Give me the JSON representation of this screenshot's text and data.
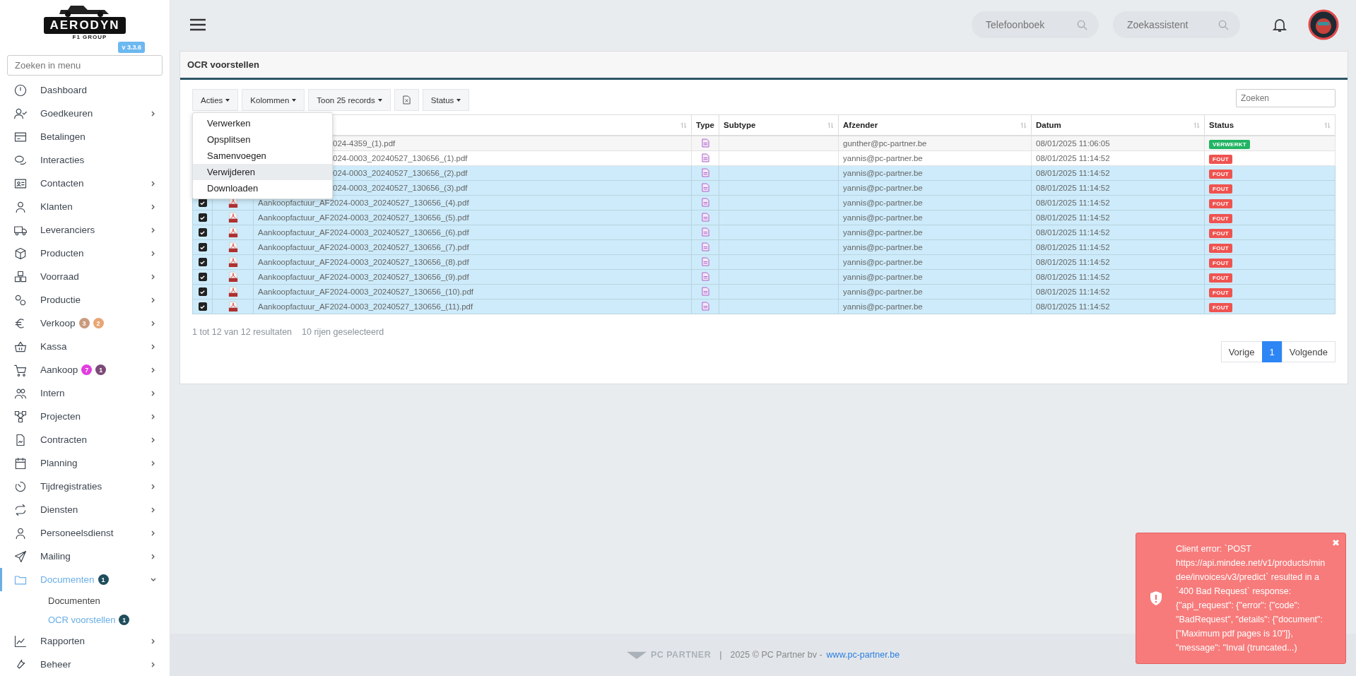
{
  "logo": {
    "name": "AERODYN",
    "tagline": "F1 GROUP",
    "version": "v 3.3.6"
  },
  "menu_search": {
    "placeholder": "Zoeken in menu"
  },
  "sidebar": {
    "items": [
      {
        "label": "Dashboard",
        "has_children": false,
        "expanded": false,
        "selected": false
      },
      {
        "label": "Goedkeuren",
        "has_children": true,
        "expanded": false,
        "selected": false
      },
      {
        "label": "Betalingen",
        "has_children": false,
        "expanded": false,
        "selected": false
      },
      {
        "label": "Interacties",
        "has_children": false,
        "expanded": false,
        "selected": false
      },
      {
        "label": "Contacten",
        "has_children": true,
        "expanded": false,
        "selected": false
      },
      {
        "label": "Klanten",
        "has_children": true,
        "expanded": false,
        "selected": false
      },
      {
        "label": "Leveranciers",
        "has_children": true,
        "expanded": false,
        "selected": false
      },
      {
        "label": "Producten",
        "has_children": true,
        "expanded": false,
        "selected": false
      },
      {
        "label": "Voorraad",
        "has_children": true,
        "expanded": false,
        "selected": false
      },
      {
        "label": "Productie",
        "has_children": true,
        "expanded": false,
        "selected": false
      },
      {
        "label": "Verkoop",
        "has_children": true,
        "expanded": false,
        "selected": false,
        "badges": [
          {
            "text": "3",
            "color": "#c99a7e"
          },
          {
            "text": "2",
            "color": "#e8a674"
          }
        ]
      },
      {
        "label": "Kassa",
        "has_children": true,
        "expanded": false,
        "selected": false
      },
      {
        "label": "Aankoop",
        "has_children": true,
        "expanded": false,
        "selected": false,
        "badges": [
          {
            "text": "7",
            "color": "#e03ee0"
          },
          {
            "text": "1",
            "color": "#7b4a78"
          }
        ]
      },
      {
        "label": "Intern",
        "has_children": true,
        "expanded": false,
        "selected": false
      },
      {
        "label": "Projecten",
        "has_children": true,
        "expanded": false,
        "selected": false
      },
      {
        "label": "Contracten",
        "has_children": true,
        "expanded": false,
        "selected": false
      },
      {
        "label": "Planning",
        "has_children": true,
        "expanded": false,
        "selected": false
      },
      {
        "label": "Tijdregistraties",
        "has_children": true,
        "expanded": false,
        "selected": false
      },
      {
        "label": "Diensten",
        "has_children": true,
        "expanded": false,
        "selected": false
      },
      {
        "label": "Personeelsdienst",
        "has_children": true,
        "expanded": false,
        "selected": false
      },
      {
        "label": "Mailing",
        "has_children": true,
        "expanded": false,
        "selected": false
      },
      {
        "label": "Documenten",
        "has_children": true,
        "expanded": true,
        "selected": true,
        "badges": [
          {
            "text": "1",
            "color": "#1f4d5c"
          }
        ],
        "children": [
          {
            "label": "Documenten",
            "selected": false
          },
          {
            "label": "OCR voorstellen",
            "selected": true,
            "badges": [
              {
                "text": "1",
                "color": "#1f4d5c"
              }
            ]
          }
        ]
      },
      {
        "label": "Rapporten",
        "has_children": true,
        "expanded": false,
        "selected": false
      },
      {
        "label": "Beheer",
        "has_children": true,
        "expanded": false,
        "selected": false
      }
    ]
  },
  "topbar": {
    "searches": [
      {
        "placeholder": "Telefoonboek"
      },
      {
        "placeholder": "Zoekassistent"
      }
    ]
  },
  "card": {
    "title": "OCR voorstellen",
    "toolbar": [
      {
        "label": "Acties",
        "kind": "dropdown"
      },
      {
        "label": "Kolommen",
        "kind": "dropdown"
      },
      {
        "label": "Toon 25 records",
        "kind": "dropdown"
      },
      {
        "kind": "excel"
      },
      {
        "label": "Status",
        "kind": "dropdown"
      }
    ],
    "actions_menu": {
      "open": true,
      "items": [
        {
          "label": "Verwerken",
          "selected": false
        },
        {
          "label": "Opsplitsen",
          "selected": false
        },
        {
          "label": "Samenvoegen",
          "selected": false
        },
        {
          "label": "Verwijderen",
          "selected": true
        },
        {
          "label": "Downloaden",
          "selected": false
        }
      ]
    },
    "search": {
      "placeholder": "Zoeken"
    },
    "table": {
      "columns": [
        "Type",
        "Subtype",
        "Afzender",
        "Datum",
        "Status"
      ],
      "rows": [
        {
          "selected": false,
          "name": "024-4359_(1).pdf",
          "sender": "gunther@pc-partner.be",
          "date": "08/01/2025 11:06:05",
          "status": {
            "label": "VERWERKT",
            "color": "#22b463"
          }
        },
        {
          "selected": false,
          "name": "024-0003_20240527_130656_(1).pdf",
          "sender": "yannis@pc-partner.be",
          "date": "08/01/2025 11:14:52",
          "status": {
            "label": "FOUT",
            "color": "#ef5350"
          }
        },
        {
          "selected": true,
          "name": "024-0003_20240527_130656_(2).pdf",
          "sender": "yannis@pc-partner.be",
          "date": "08/01/2025 11:14:52",
          "status": {
            "label": "FOUT",
            "color": "#ef5350"
          }
        },
        {
          "selected": true,
          "name": "024-0003_20240527_130656_(3).pdf",
          "sender": "yannis@pc-partner.be",
          "date": "08/01/2025 11:14:52",
          "status": {
            "label": "FOUT",
            "color": "#ef5350"
          }
        },
        {
          "selected": true,
          "name": "Aankoopfactuur_AF2024-0003_20240527_130656_(4).pdf",
          "sender": "yannis@pc-partner.be",
          "date": "08/01/2025 11:14:52",
          "status": {
            "label": "FOUT",
            "color": "#ef5350"
          }
        },
        {
          "selected": true,
          "name": "Aankoopfactuur_AF2024-0003_20240527_130656_(5).pdf",
          "sender": "yannis@pc-partner.be",
          "date": "08/01/2025 11:14:52",
          "status": {
            "label": "FOUT",
            "color": "#ef5350"
          }
        },
        {
          "selected": true,
          "name": "Aankoopfactuur_AF2024-0003_20240527_130656_(6).pdf",
          "sender": "yannis@pc-partner.be",
          "date": "08/01/2025 11:14:52",
          "status": {
            "label": "FOUT",
            "color": "#ef5350"
          }
        },
        {
          "selected": true,
          "name": "Aankoopfactuur_AF2024-0003_20240527_130656_(7).pdf",
          "sender": "yannis@pc-partner.be",
          "date": "08/01/2025 11:14:52",
          "status": {
            "label": "FOUT",
            "color": "#ef5350"
          }
        },
        {
          "selected": true,
          "name": "Aankoopfactuur_AF2024-0003_20240527_130656_(8).pdf",
          "sender": "yannis@pc-partner.be",
          "date": "08/01/2025 11:14:52",
          "status": {
            "label": "FOUT",
            "color": "#ef5350"
          }
        },
        {
          "selected": true,
          "name": "Aankoopfactuur_AF2024-0003_20240527_130656_(9).pdf",
          "sender": "yannis@pc-partner.be",
          "date": "08/01/2025 11:14:52",
          "status": {
            "label": "FOUT",
            "color": "#ef5350"
          }
        },
        {
          "selected": true,
          "name": "Aankoopfactuur_AF2024-0003_20240527_130656_(10).pdf",
          "sender": "yannis@pc-partner.be",
          "date": "08/01/2025 11:14:52",
          "status": {
            "label": "FOUT",
            "color": "#ef5350"
          }
        },
        {
          "selected": true,
          "name": "Aankoopfactuur_AF2024-0003_20240527_130656_(11).pdf",
          "sender": "yannis@pc-partner.be",
          "date": "08/01/2025 11:14:52",
          "status": {
            "label": "FOUT",
            "color": "#ef5350"
          }
        }
      ]
    },
    "info": [
      "1 tot 12 van 12 resultaten",
      "10 rijen geselecteerd"
    ],
    "pagination": [
      {
        "label": "Vorige",
        "selected": false
      },
      {
        "label": "1",
        "selected": true
      },
      {
        "label": "Volgende",
        "selected": false
      }
    ]
  },
  "footer": {
    "brand": "PC PARTNER",
    "separator": "|",
    "copyright": "2025 © PC Partner bv - ",
    "link": "www.pc-partner.be"
  },
  "toast": {
    "close": "✖",
    "message": "Client error: `POST https://api.mindee.net/v1/products/mindee/invoices/v3/predict` resulted in a `400 Bad Request` response: {\"api_request\": {\"error\": {\"code\": \"BadRequest\", \"details\": {\"document\": [\"Maximum pdf pages is 10\"]}, \"message\": \"Inval (truncated...)"
  }
}
